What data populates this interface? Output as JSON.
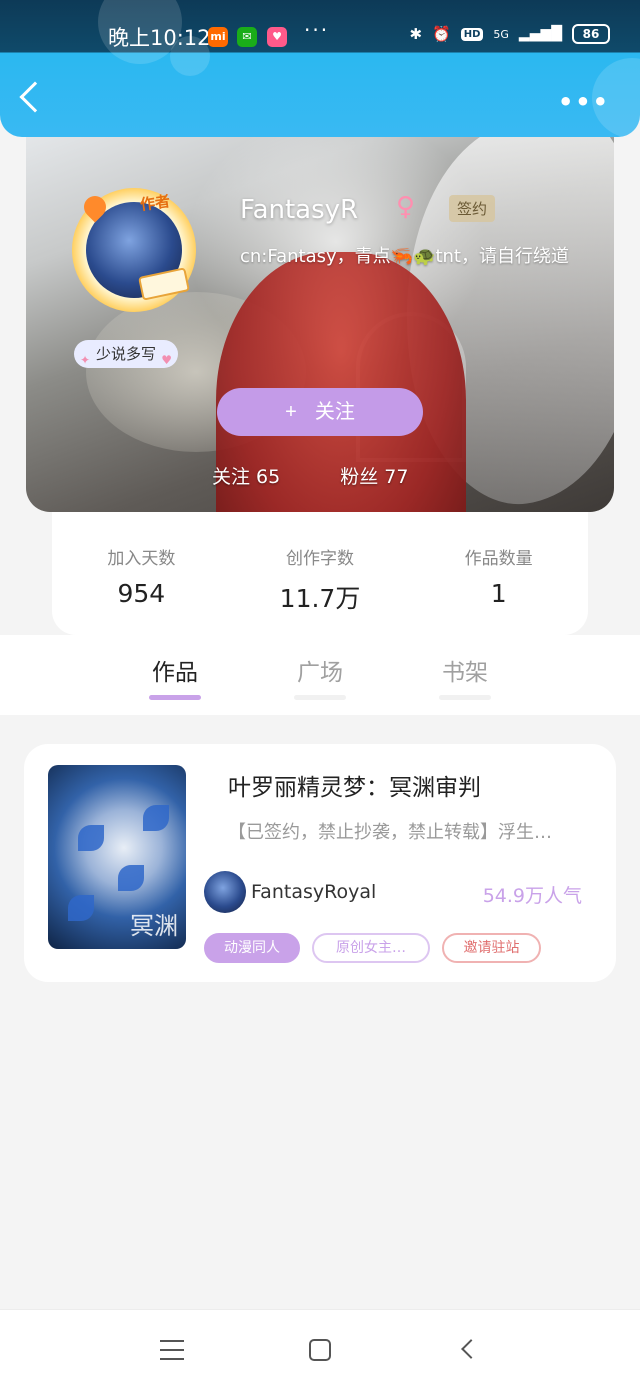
{
  "status_bar": {
    "time": "晚上10:12",
    "app_icons": [
      "mi-icon",
      "wechat-icon",
      "app-icon"
    ],
    "more": "···",
    "hd": "HD",
    "network": "5G",
    "battery": "86"
  },
  "header": {
    "back_icon": "chevron-left-icon",
    "more_icon": "more-horizontal-icon"
  },
  "profile": {
    "author_badge": "作者",
    "username": "FantasyR",
    "gender_symbol": "♀",
    "signed_badge": "签约",
    "bio": "cn:Fantasy，青点🦐🐢tnt，请自行绕道",
    "tag": "少说多写",
    "follow_button": "关注",
    "follow_plus": "+",
    "following": "关注 65",
    "followers": "粉丝 77"
  },
  "stats": [
    {
      "label": "加入天数",
      "value": "954"
    },
    {
      "label": "创作字数",
      "value": "11.7万"
    },
    {
      "label": "作品数量",
      "value": "1"
    }
  ],
  "tabs": [
    {
      "label": "作品",
      "active": true
    },
    {
      "label": "广场",
      "active": false
    },
    {
      "label": "书架",
      "active": false
    }
  ],
  "work": {
    "title": "叶罗丽精灵梦：冥渊审判",
    "description": "【已签约，禁止抄袭，禁止转载】浮生…",
    "cover_text": "冥渊",
    "author": "FantasyRoyal",
    "popularity": "54.9万人气",
    "tags": [
      "动漫同人",
      "原创女主…",
      "邀请驻站"
    ]
  },
  "colors": {
    "accent": "#c9a2e9",
    "header_blue": "#39b9f3",
    "invite_red": "#e06f6f"
  },
  "navbar": {
    "icons": [
      "menu-icon",
      "home-icon",
      "back-icon"
    ]
  }
}
